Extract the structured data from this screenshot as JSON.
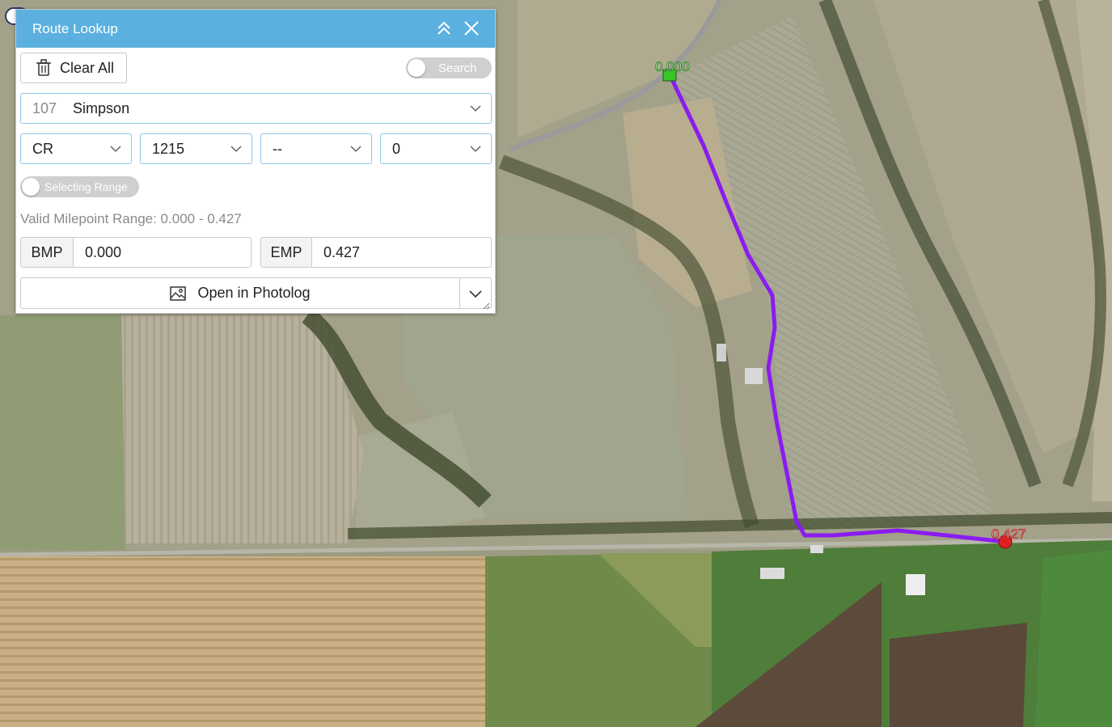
{
  "panel": {
    "title": "Route Lookup",
    "clear_label": "Clear All",
    "search_toggle_label": "Search",
    "route": {
      "number": "107",
      "name": "Simpson"
    },
    "selects": [
      "CR",
      "1215",
      "--",
      "0"
    ],
    "range_toggle_label": "Selecting Range",
    "valid_range_text": "Valid Milepoint Range: 0.000 - 0.427",
    "bmp_label": "BMP",
    "bmp_value": "0.000",
    "emp_label": "EMP",
    "emp_value": "0.427",
    "photolog_label": "Open in Photolog"
  },
  "map": {
    "start_label": "0.000",
    "end_label": "0.427",
    "route_color": "#8a1cf0",
    "start_color": "#37c627",
    "end_color": "#e02020"
  },
  "colors": {
    "header": "#5bb0df",
    "input_border": "#8cc7e8"
  }
}
